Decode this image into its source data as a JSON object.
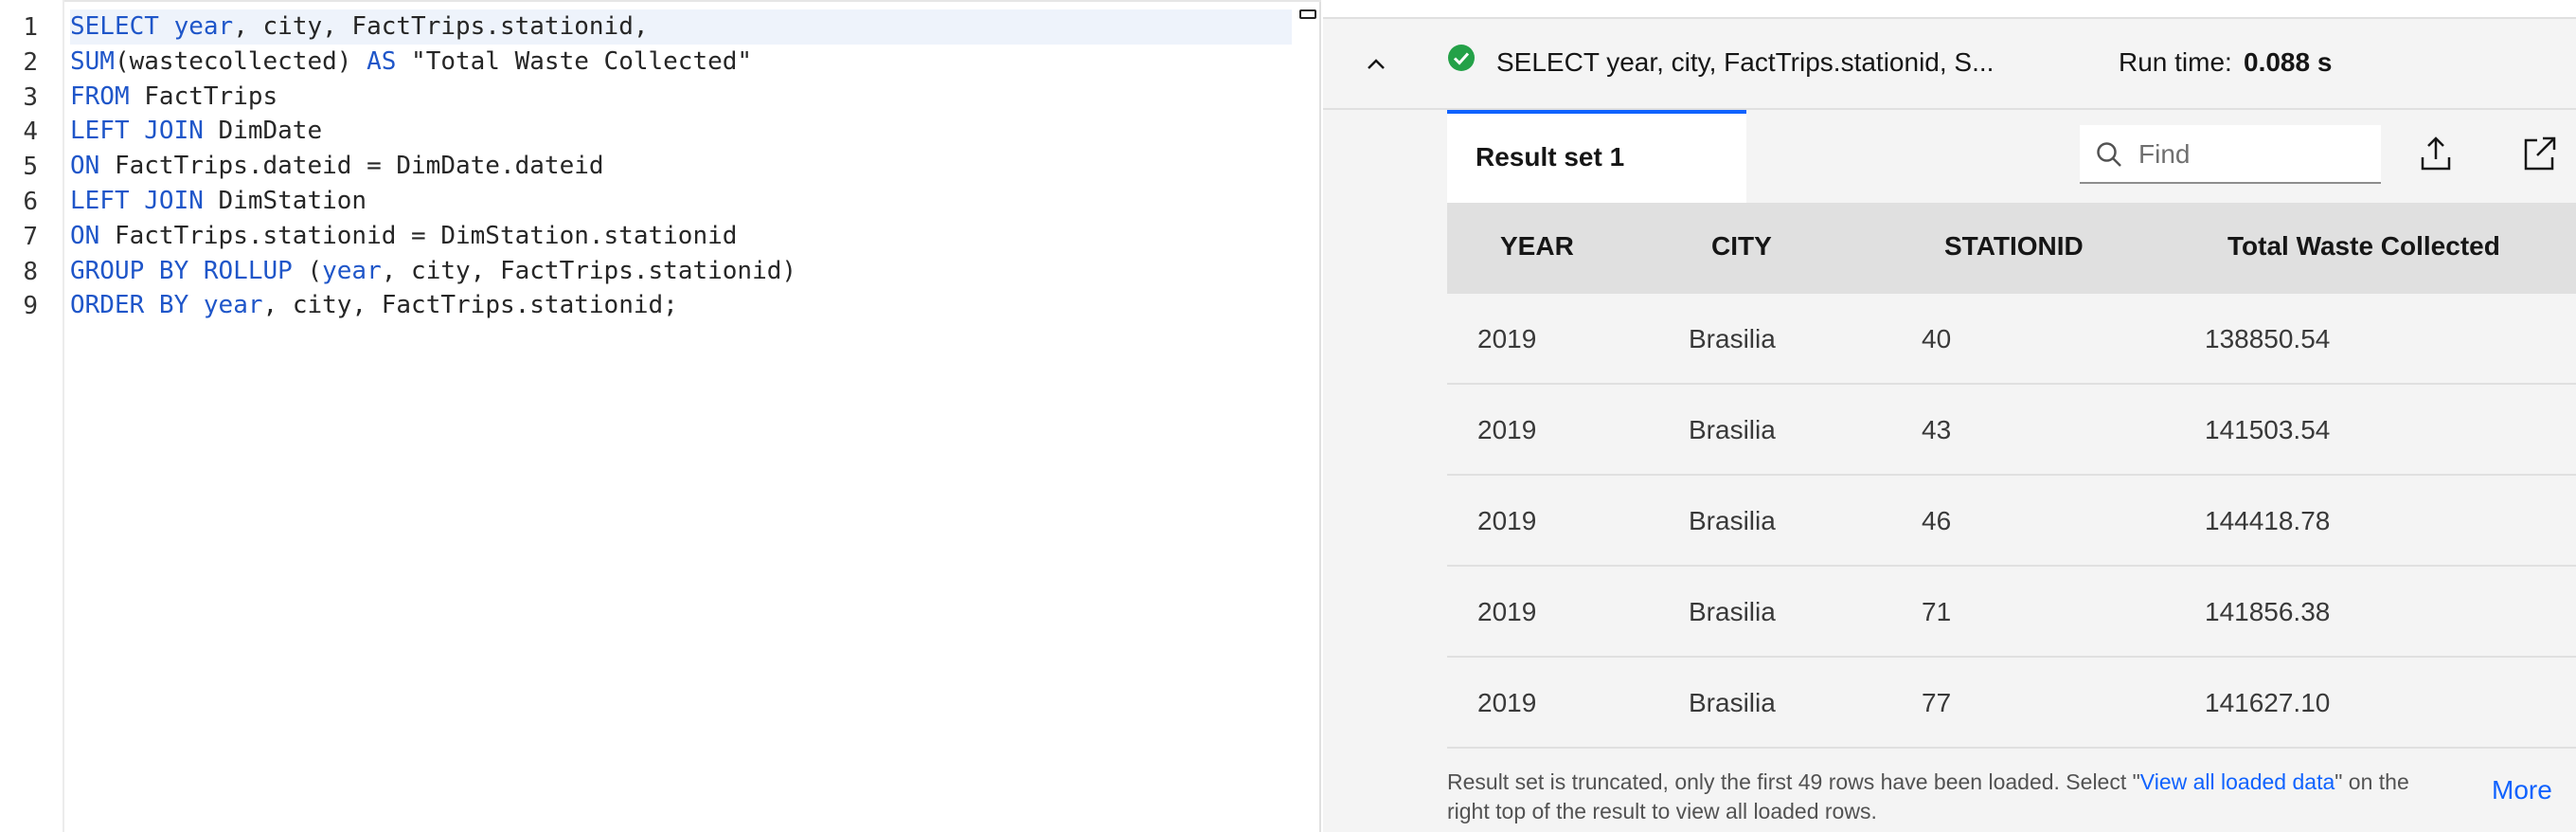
{
  "editor": {
    "line_numbers": [
      "1",
      "2",
      "3",
      "4",
      "5",
      "6",
      "7",
      "8",
      "9"
    ],
    "lines": [
      [
        {
          "t": "SELECT ",
          "k": true
        },
        {
          "t": "year",
          "k": true
        },
        {
          "t": ", city, FactTrips.stationid,",
          "k": false
        }
      ],
      [
        {
          "t": "SUM",
          "k": true
        },
        {
          "t": "(wastecollected) ",
          "k": false
        },
        {
          "t": "AS",
          "k": true
        },
        {
          "t": " \"Total Waste Collected\"",
          "k": false
        }
      ],
      [
        {
          "t": "FROM",
          "k": true
        },
        {
          "t": " FactTrips",
          "k": false
        }
      ],
      [
        {
          "t": "LEFT JOIN",
          "k": true
        },
        {
          "t": " DimDate",
          "k": false
        }
      ],
      [
        {
          "t": "ON",
          "k": true
        },
        {
          "t": " FactTrips.dateid = DimDate.dateid",
          "k": false
        }
      ],
      [
        {
          "t": "LEFT JOIN",
          "k": true
        },
        {
          "t": " DimStation",
          "k": false
        }
      ],
      [
        {
          "t": "ON",
          "k": true
        },
        {
          "t": " FactTrips.stationid = DimStation.stationid",
          "k": false
        }
      ],
      [
        {
          "t": "GROUP BY ROLLUP",
          "k": true
        },
        {
          "t": " (",
          "k": false
        },
        {
          "t": "year",
          "k": true
        },
        {
          "t": ", city, FactTrips.stationid)",
          "k": false
        }
      ],
      [
        {
          "t": "ORDER BY",
          "k": true
        },
        {
          "t": " ",
          "k": false
        },
        {
          "t": "year",
          "k": true
        },
        {
          "t": ", city, FactTrips.stationid;",
          "k": false
        }
      ]
    ]
  },
  "results": {
    "query_summary": "SELECT year, city, FactTrips.stationid, S...",
    "runtime_label": "Run time:",
    "runtime_value": "0.088 s",
    "tab_label": "Result set 1",
    "find_placeholder": "Find",
    "columns": [
      "YEAR",
      "CITY",
      "STATIONID",
      "Total Waste Collected"
    ],
    "rows": [
      [
        "2019",
        "Brasilia",
        "40",
        "138850.54"
      ],
      [
        "2019",
        "Brasilia",
        "43",
        "141503.54"
      ],
      [
        "2019",
        "Brasilia",
        "46",
        "144418.78"
      ],
      [
        "2019",
        "Brasilia",
        "71",
        "141856.38"
      ],
      [
        "2019",
        "Brasilia",
        "77",
        "141627.10"
      ]
    ],
    "notice_before": "Result set is truncated, only the first 49 rows have been loaded. Select \"",
    "notice_link": "View all loaded data",
    "notice_after": "\" on the right top of the result to view all loaded rows.",
    "more_label": "More"
  },
  "colors": {
    "keyword": "#1f56c9",
    "accent": "#0f62fe",
    "success": "#24a148"
  },
  "icons": [
    "chevron-up-icon",
    "success-check-icon",
    "search-icon",
    "export-icon",
    "popout-icon"
  ]
}
